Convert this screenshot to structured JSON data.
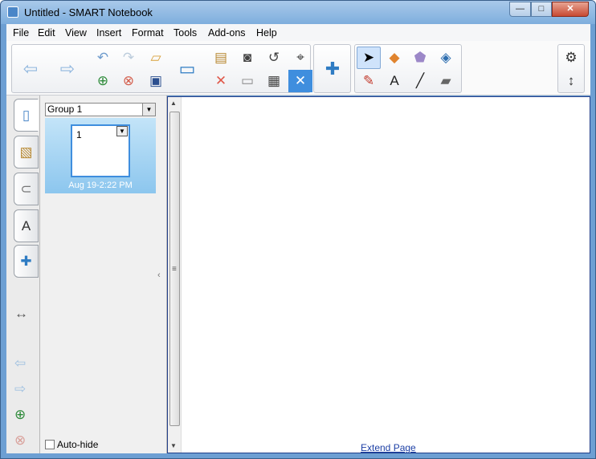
{
  "window": {
    "title": "Untitled - SMART Notebook",
    "minimize": "—",
    "maximize": "□",
    "close": "✕"
  },
  "menu": [
    "File",
    "Edit",
    "View",
    "Insert",
    "Format",
    "Tools",
    "Add-ons",
    "Help"
  ],
  "toolbar": {
    "icons": [
      "back-arrow-icon",
      "forward-arrow-icon",
      "undo-icon",
      "redo-icon",
      "open-file-icon",
      "new-page-icon",
      "delete-page-icon",
      "save-icon",
      "screen-shade-icon",
      "paste-icon",
      "delete-icon",
      "capture-icon",
      "screen-icon",
      "document-camera-icon",
      "table-icon",
      "measurement-tools-icon",
      "close-x-icon",
      "add-ons-icon",
      "select-icon",
      "shapes-icon",
      "fill-icon",
      "pens-icon",
      "text-icon",
      "line-icon",
      "eraser-icon",
      "settings-icon",
      "move-toolbar-icon"
    ]
  },
  "sidebar": {
    "group_label": "Group 1",
    "page_number": "1",
    "page_date": "Aug 19-2:22 PM",
    "autohide_label": "Auto-hide",
    "tabs": [
      "page-sorter-tab",
      "gallery-tab",
      "attachments-tab",
      "properties-tab",
      "add-ons-tab"
    ]
  },
  "canvas": {
    "extend_label": "Extend Page"
  },
  "colors": {
    "accent": "#3f8ede",
    "title_bar": "#7eaedd",
    "panel": "#f0f0f0"
  }
}
